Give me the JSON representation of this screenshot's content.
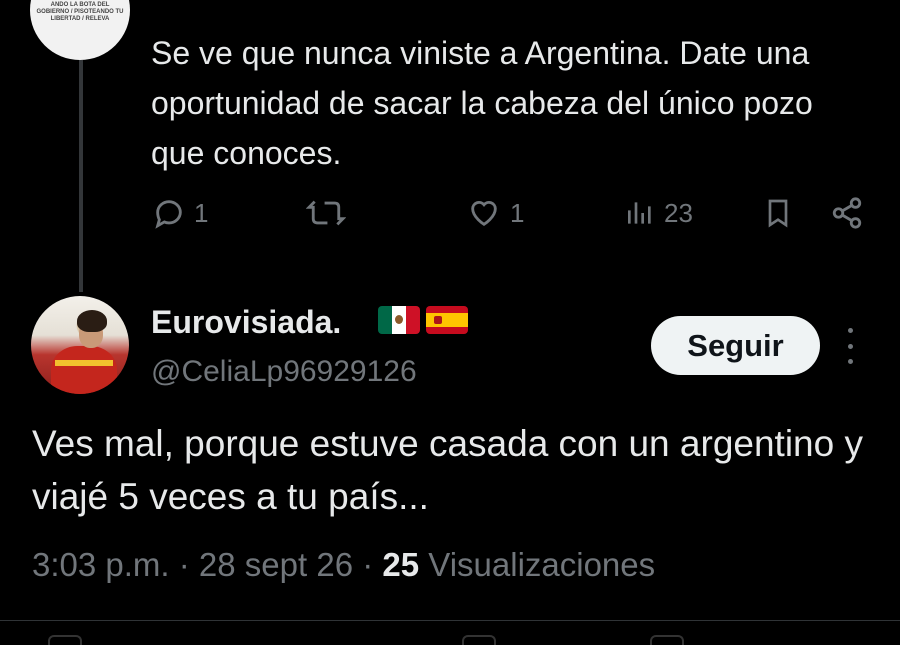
{
  "reply": {
    "avatar_caption": "ANDO LA BOTA DEL GOBIERNO / PISOTEANDO TU LIBERTAD / RELEVA",
    "text": "Se ve que nunca viniste a Argentina. Date una oportunidad de sacar la cabeza del único pozo que conoces.",
    "replies": "1",
    "likes": "1",
    "views": "23",
    "icons": [
      "reply-icon",
      "retweet-icon",
      "like-icon",
      "views-icon",
      "bookmark-icon",
      "share-icon"
    ]
  },
  "tweet": {
    "display_name": "Eurovisiada.",
    "flags": [
      "mexico-flag",
      "spain-flag"
    ],
    "handle": "@CeliaLp96929126",
    "follow_label": "Seguir",
    "text": "Ves mal, porque estuve casada con un argentino y viajé 5 veces a tu país...",
    "time": "3:03 p.m.",
    "date": "28 sept 26",
    "separator": "·",
    "view_count": "25",
    "view_label": "Visualizaciones"
  },
  "colors": {
    "background": "#000000",
    "text": "#e7e9ea",
    "muted": "#71767b",
    "button_bg": "#eff3f4",
    "button_text": "#0f1419"
  }
}
